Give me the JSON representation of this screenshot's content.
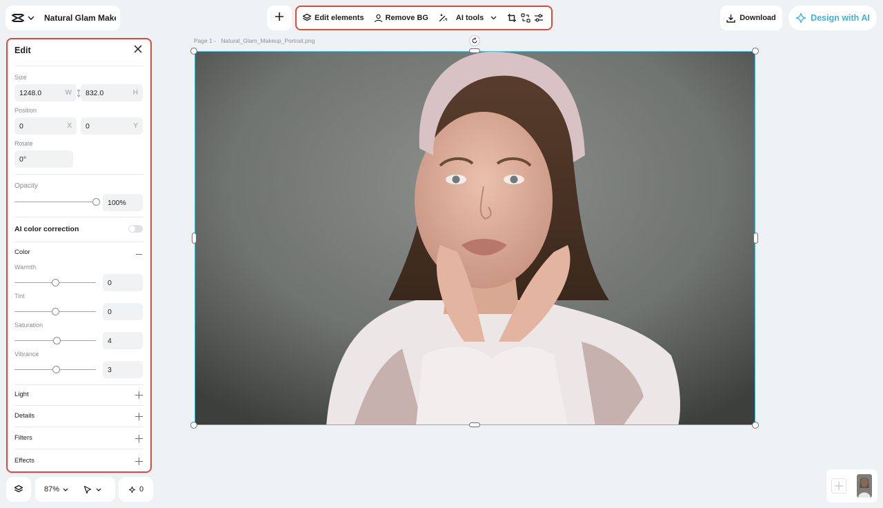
{
  "header": {
    "project_name": "Natural Glam Make...",
    "toolbar": {
      "edit_elements": "Edit elements",
      "remove_bg": "Remove BG",
      "ai_tools": "AI tools"
    },
    "download": "Download",
    "design_with_ai": "Design with AI",
    "accent_color": "#37b6e0"
  },
  "edit_panel": {
    "title": "Edit",
    "size": {
      "label": "Size",
      "width": "1248.0",
      "width_suffix": "W",
      "height": "832.0",
      "height_suffix": "H"
    },
    "position": {
      "label": "Position",
      "x": "0",
      "x_suffix": "X",
      "y": "0",
      "y_suffix": "Y"
    },
    "rotate": {
      "label": "Rotate",
      "value": "0°"
    },
    "opacity": {
      "label": "Opacity",
      "value": "100%",
      "level": 1.0
    },
    "ai_color_correction": {
      "label": "AI color correction",
      "enabled": false
    },
    "color": {
      "label": "Color",
      "sliders": [
        {
          "label": "Warmth",
          "value": "0"
        },
        {
          "label": "Tint",
          "value": "0"
        },
        {
          "label": "Saturation",
          "value": "4"
        },
        {
          "label": "Vibrance",
          "value": "3"
        }
      ]
    },
    "sections": [
      "Light",
      "Details",
      "Filters",
      "Effects"
    ]
  },
  "canvas": {
    "page_label": "Page 1 -",
    "file_name": "Natural_Glam_Makeup_Portrait.png"
  },
  "bottom_bar": {
    "zoom": "87%",
    "ai_credits": "0"
  }
}
